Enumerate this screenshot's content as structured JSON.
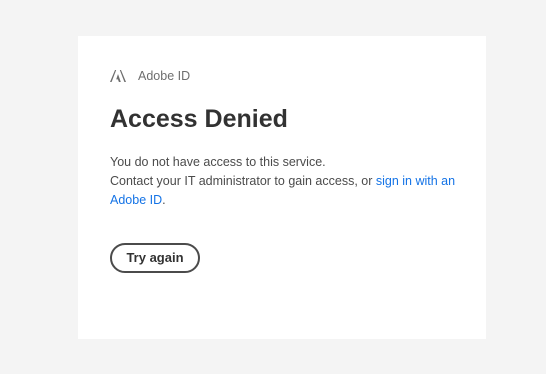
{
  "brand": {
    "label": "Adobe ID",
    "icon": "adobe-logo-icon"
  },
  "page": {
    "title": "Access Denied"
  },
  "message": {
    "line1": "You do not have access to this service.",
    "line2_prefix": "Contact your IT administrator to gain access, or ",
    "link_text": "sign in with an Adobe ID",
    "line2_suffix": "."
  },
  "actions": {
    "try_again_label": "Try again"
  },
  "colors": {
    "background": "#f4f4f4",
    "card": "#ffffff",
    "link": "#1473e6",
    "heading": "#323232"
  }
}
